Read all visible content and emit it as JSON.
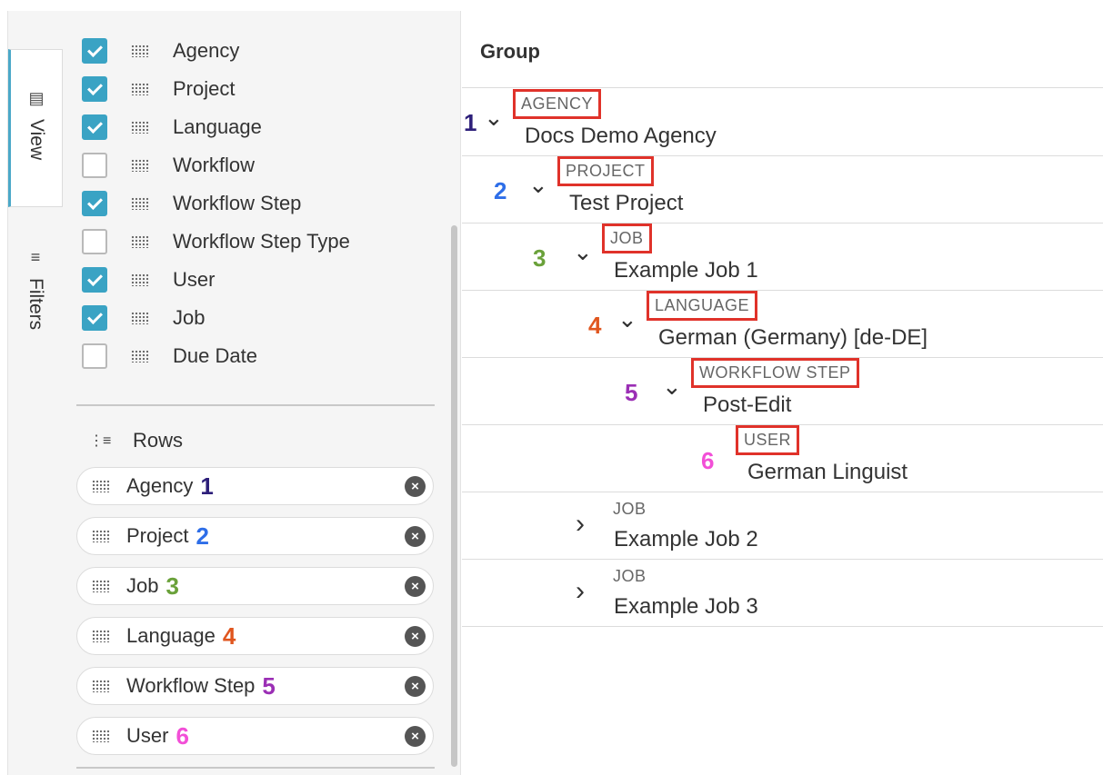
{
  "rail": {
    "view_label": "View",
    "filters_label": "Filters",
    "view_icon": "table-icon",
    "filters_icon": "menu-icon"
  },
  "columns": [
    {
      "label": "Agency",
      "checked": true
    },
    {
      "label": "Project",
      "checked": true
    },
    {
      "label": "Language",
      "checked": true
    },
    {
      "label": "Workflow",
      "checked": false
    },
    {
      "label": "Workflow Step",
      "checked": true
    },
    {
      "label": "Workflow Step Type",
      "checked": false
    },
    {
      "label": "User",
      "checked": true
    },
    {
      "label": "Job",
      "checked": true
    },
    {
      "label": "Due Date",
      "checked": false
    }
  ],
  "rows_section": {
    "label": "Rows",
    "items": [
      {
        "label": "Agency",
        "num": "1",
        "color": "#2d1f7a"
      },
      {
        "label": "Project",
        "num": "2",
        "color": "#2e6ee8"
      },
      {
        "label": "Job",
        "num": "3",
        "color": "#6aa13a"
      },
      {
        "label": "Language",
        "num": "4",
        "color": "#e0561f"
      },
      {
        "label": "Workflow Step",
        "num": "5",
        "color": "#9b2fb5"
      },
      {
        "label": "User",
        "num": "6",
        "color": "#f24fd7"
      }
    ]
  },
  "tree": {
    "header": "Group",
    "nodes": [
      {
        "num": "1",
        "num_color": "#2d1f7a",
        "type": "AGENCY",
        "value": "Docs Demo Agency",
        "expanded": true,
        "highlight": true
      },
      {
        "num": "2",
        "num_color": "#2e6ee8",
        "type": "PROJECT",
        "value": "Test Project",
        "expanded": true,
        "highlight": true
      },
      {
        "num": "3",
        "num_color": "#6aa13a",
        "type": "JOB",
        "value": "Example Job 1",
        "expanded": true,
        "highlight": true
      },
      {
        "num": "4",
        "num_color": "#e0561f",
        "type": "LANGUAGE",
        "value": "German (Germany) [de-DE]",
        "expanded": true,
        "highlight": true
      },
      {
        "num": "5",
        "num_color": "#9b2fb5",
        "type": "WORKFLOW STEP",
        "value": "Post-Edit",
        "expanded": true,
        "highlight": true
      },
      {
        "num": "6",
        "num_color": "#f24fd7",
        "type": "USER",
        "value": "German Linguist",
        "expanded": null,
        "highlight": true
      },
      {
        "num": "",
        "num_color": "",
        "type": "JOB",
        "value": "Example Job 2",
        "expanded": false,
        "highlight": false
      },
      {
        "num": "",
        "num_color": "",
        "type": "JOB",
        "value": "Example Job 3",
        "expanded": false,
        "highlight": false
      }
    ]
  }
}
